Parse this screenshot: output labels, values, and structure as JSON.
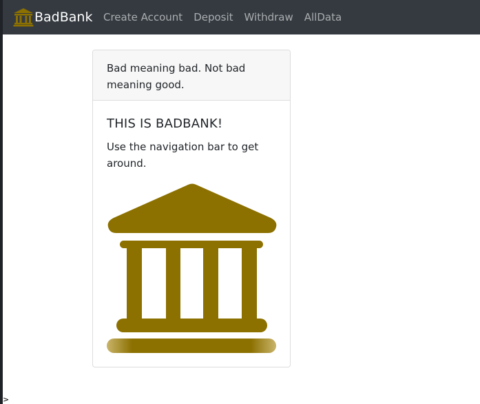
{
  "navbar": {
    "brand_icon": "bank-icon",
    "brand_name": "BadBank",
    "links": [
      {
        "label": "Create Account"
      },
      {
        "label": "Deposit"
      },
      {
        "label": "Withdraw"
      },
      {
        "label": "AllData"
      }
    ]
  },
  "card": {
    "header": "Bad meaning bad. Not bad meaning good.",
    "title": "THIS IS BADBANK!",
    "text": "Use the navigation bar to get around.",
    "image_icon": "bank-icon"
  },
  "stray_text": ">",
  "colors": {
    "navbar_bg": "#343a40",
    "brand_gold": "#8c7000",
    "card_header_bg": "#f7f7f7"
  }
}
